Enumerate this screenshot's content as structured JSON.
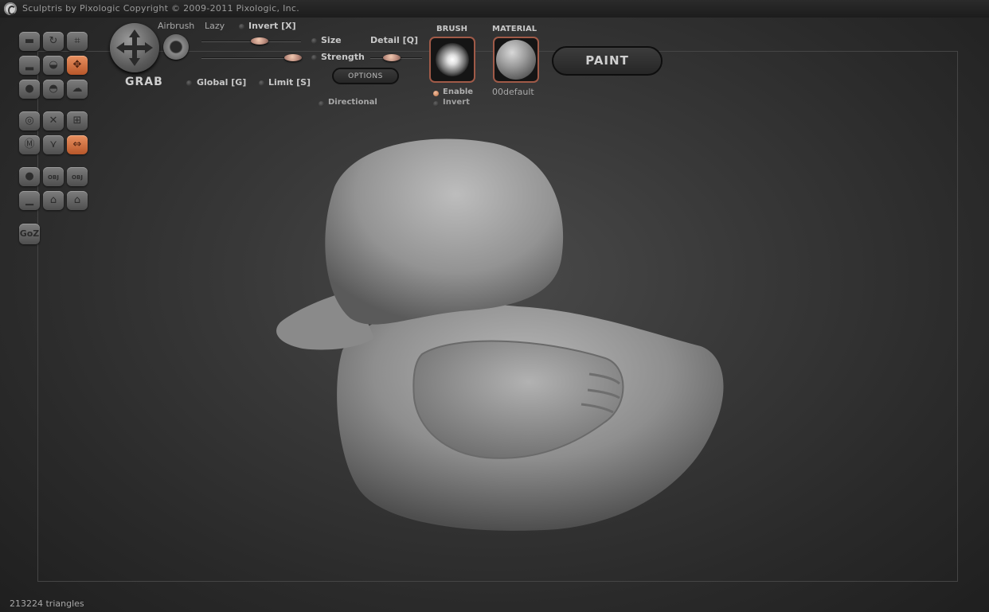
{
  "window": {
    "title": "Sculptris by Pixologic    Copyright © 2009-2011 Pixologic, Inc."
  },
  "tool": {
    "name": "GRAB"
  },
  "controls": {
    "airbrush": "Airbrush",
    "lazy": "Lazy",
    "invert": "Invert [X]",
    "size": "Size",
    "strength": "Strength",
    "detail": "Detail [Q]",
    "global": "Global [G]",
    "limit": "Limit [S]",
    "options": "OPTIONS",
    "directional": "Directional"
  },
  "brush": {
    "header": "BRUSH",
    "enable": "Enable",
    "invert": "Invert"
  },
  "material": {
    "header": "MATERIAL",
    "name": "00default"
  },
  "paint_button": "PAINT",
  "toolbar": {
    "goz": "GoZ",
    "obj": "OBJ"
  },
  "status": {
    "triangles": "213224 triangles"
  },
  "colors": {
    "accent": "#d9733e",
    "background": "#333333"
  }
}
